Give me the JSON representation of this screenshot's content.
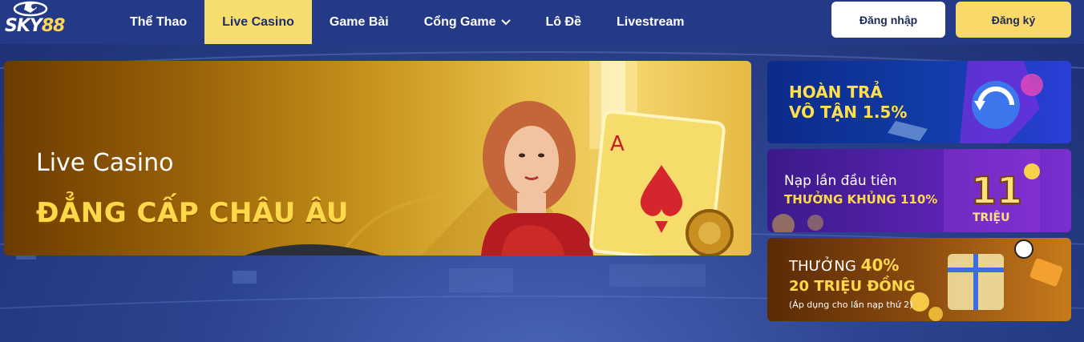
{
  "header": {
    "logo_text": "SKY",
    "logo_number": "88",
    "nav": [
      {
        "label": "Thể Thao"
      },
      {
        "label": "Live Casino"
      },
      {
        "label": "Game Bài"
      },
      {
        "label": "Cổng Game"
      },
      {
        "label": "Lô Đề"
      },
      {
        "label": "Livestream"
      }
    ],
    "active_nav": "Live Casino",
    "login_label": "Đăng nhập",
    "register_label": "Đăng ký"
  },
  "main_banner": {
    "title": "Live Casino",
    "headline": "ĐẲNG CẤP CHÂU ÂU",
    "card_rank": "A"
  },
  "promos": [
    {
      "line1": "HOÀN TRẢ",
      "line2": "VÔ TẬN 1.5%"
    },
    {
      "line1": "Nạp lần đầu tiên",
      "line2": "THƯỞNG KHỦNG 110%",
      "badge_number": "11",
      "badge_unit": "TRIỆU"
    },
    {
      "line1_prefix": "THƯỞNG",
      "line1_highlight": "40%",
      "line2": "20 TRIỆU ĐỒNG",
      "line3": "(Áp dụng cho lần nạp thứ 2)"
    }
  ],
  "colors": {
    "header_bg": "#253a86",
    "active_tab": "#f7dd6e",
    "register_button": "#f9d96a",
    "headline_gold": "#ffd94a"
  }
}
